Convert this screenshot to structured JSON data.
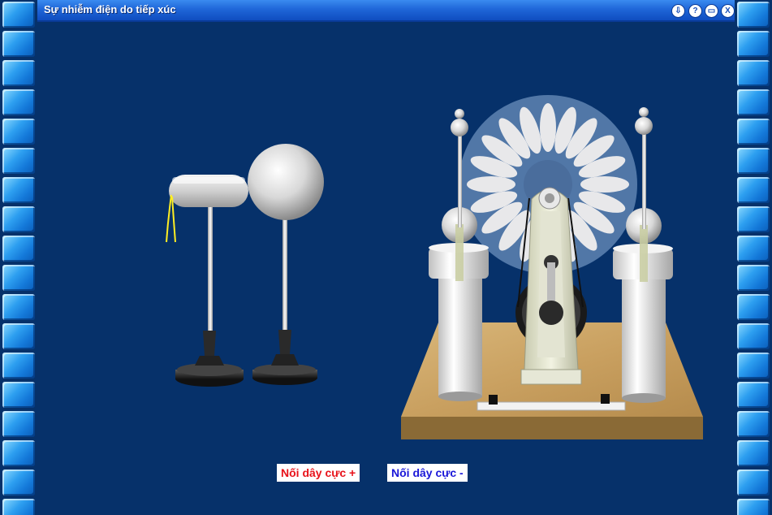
{
  "window": {
    "title": "Sự nhiễm điện do tiếp xúc",
    "buttons": [
      {
        "name": "download-icon",
        "glyph": "⇩"
      },
      {
        "name": "help-icon",
        "glyph": "?"
      },
      {
        "name": "minimize-icon",
        "glyph": "▭"
      },
      {
        "name": "close-icon",
        "glyph": "X"
      }
    ]
  },
  "controls": {
    "connect_positive": "Nối dây cực +",
    "connect_negative": "Nối dây cực -"
  },
  "colors": {
    "positive": "#e8121a",
    "negative": "#1a16d8",
    "background": "#06316a"
  }
}
